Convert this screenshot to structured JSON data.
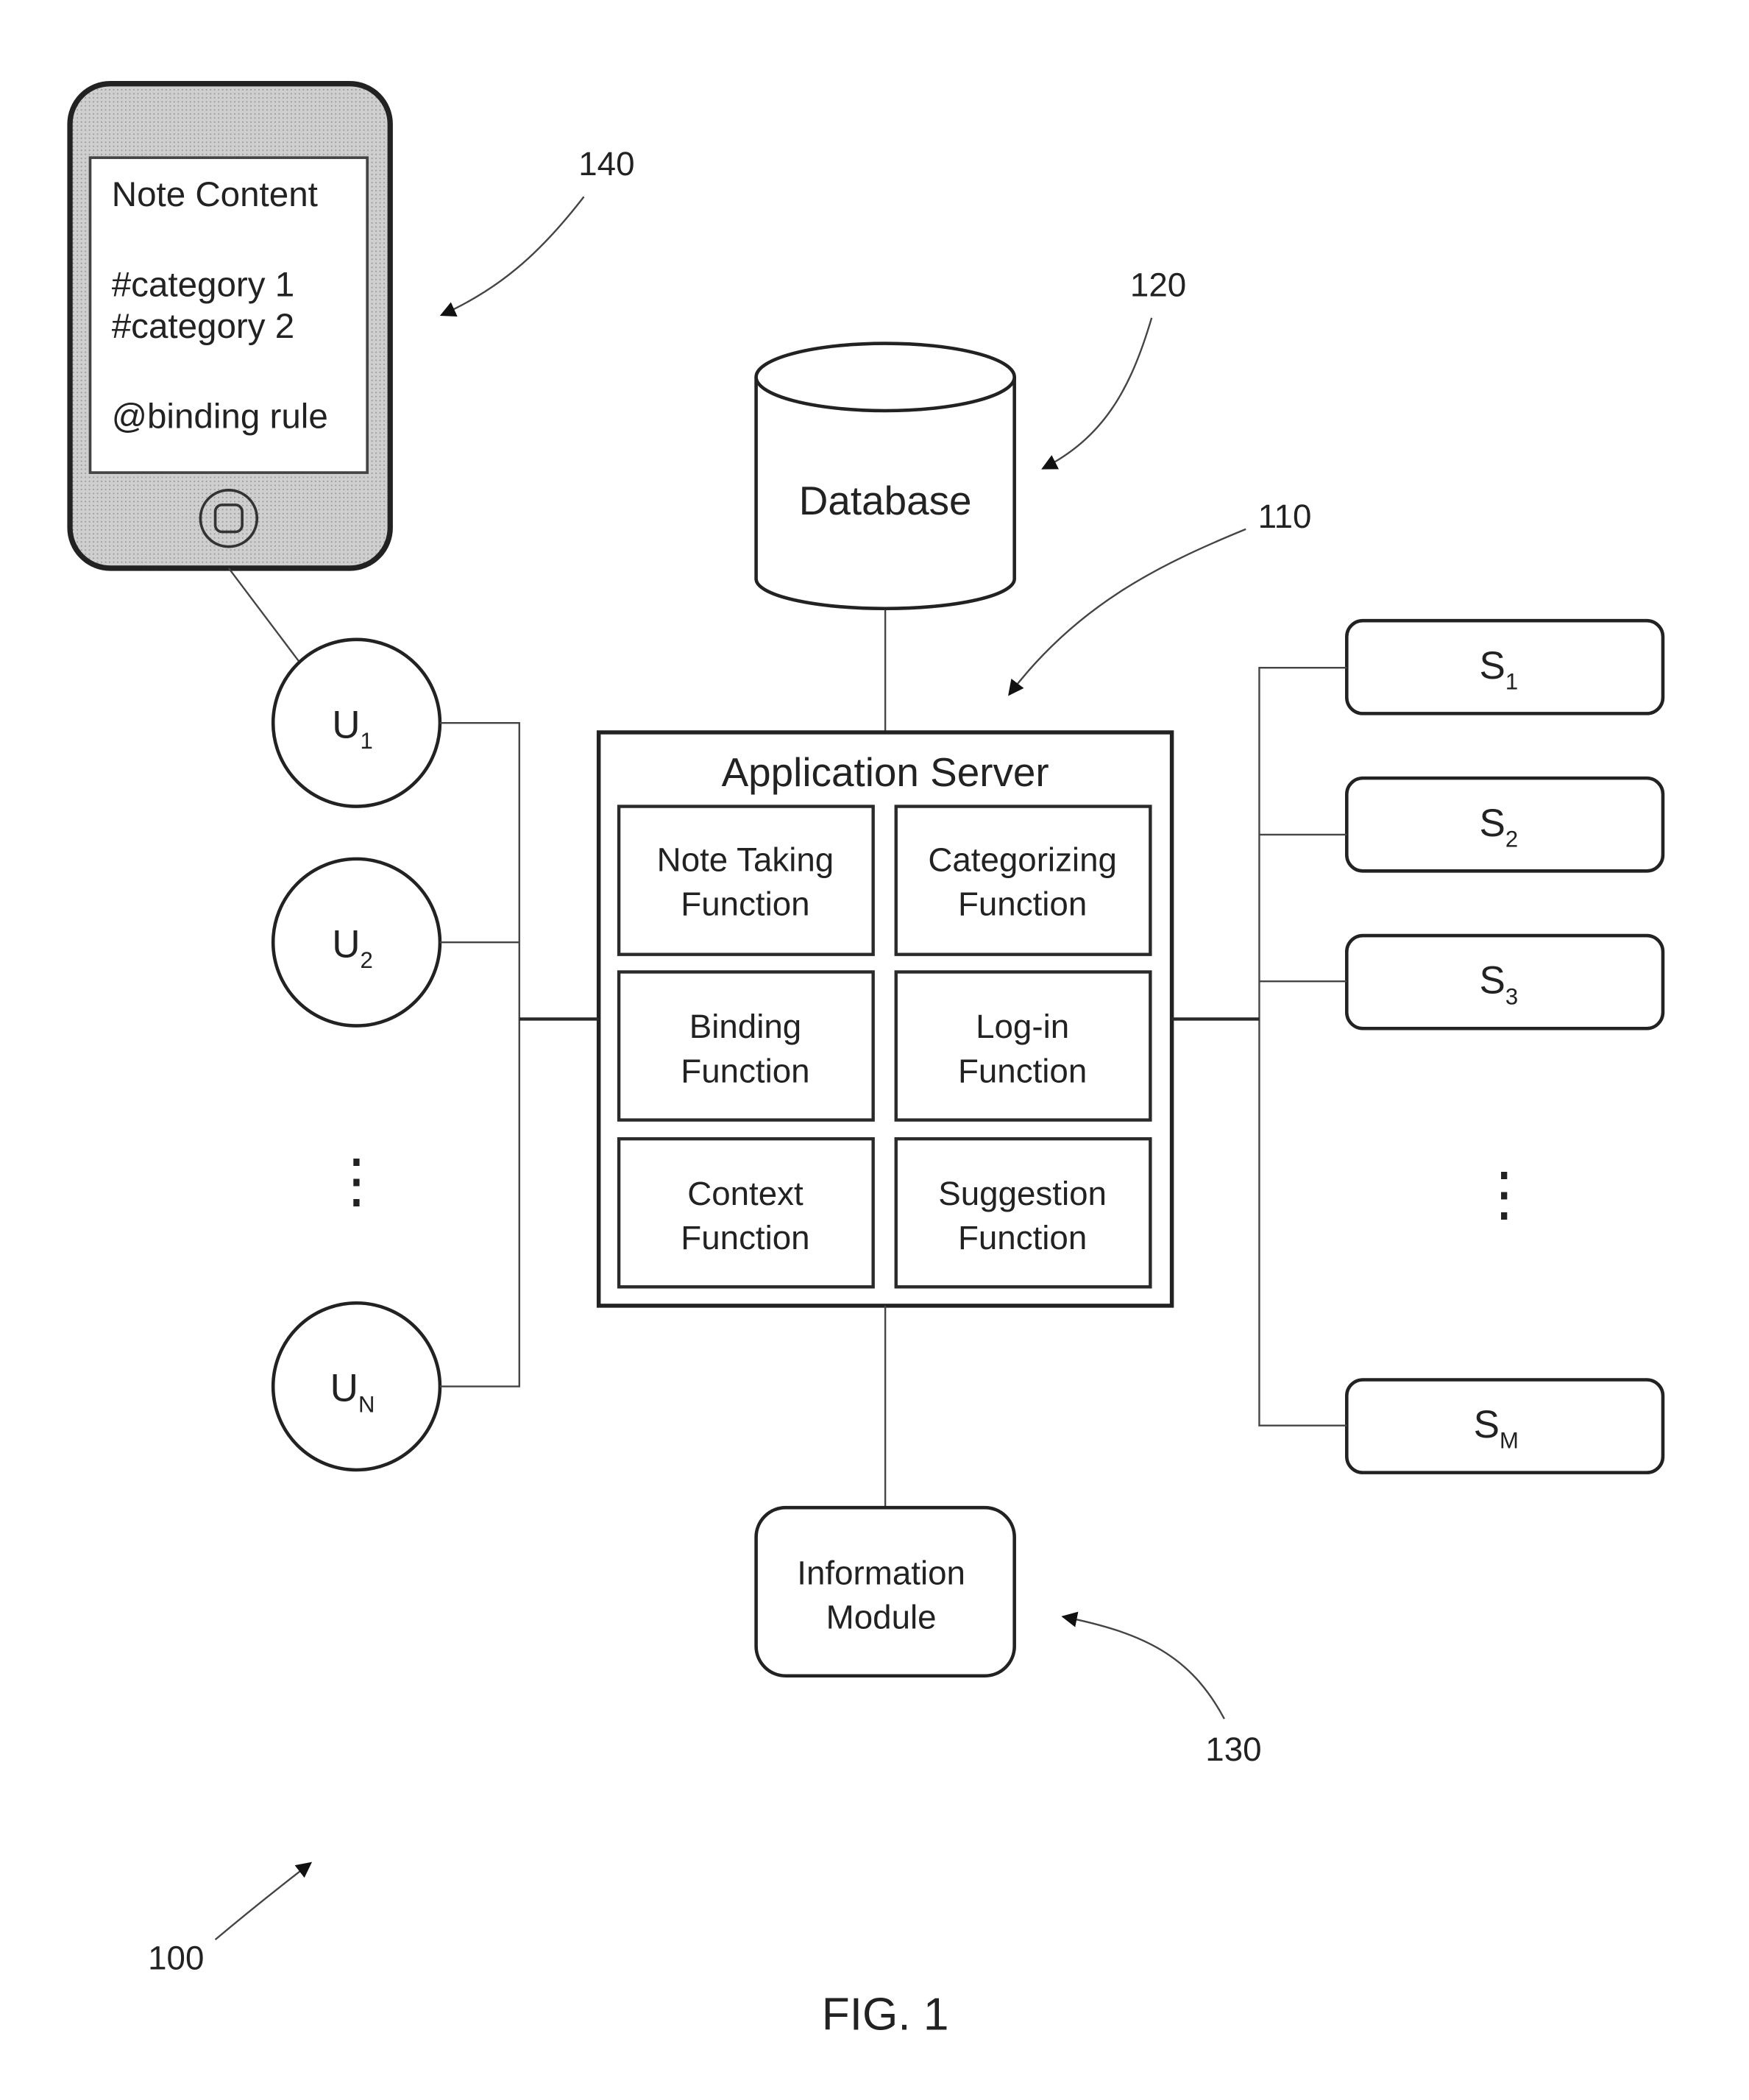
{
  "figure": {
    "caption": "FIG. 1",
    "system_ref": "100"
  },
  "device": {
    "ref": "140",
    "screen_lines": [
      "Note Content",
      "#category 1",
      "#category 2",
      "@binding rule"
    ],
    "colors": {
      "body": "#c8c8c8",
      "screen": "#ffffff"
    }
  },
  "database": {
    "ref": "120",
    "label": "Database"
  },
  "application_server": {
    "ref": "110",
    "title": "Application Server",
    "functions": [
      {
        "line1": "Note Taking",
        "line2": "Function"
      },
      {
        "line1": "Categorizing",
        "line2": "Function"
      },
      {
        "line1": "Binding",
        "line2": "Function"
      },
      {
        "line1": "Log-in",
        "line2": "Function"
      },
      {
        "line1": "Context",
        "line2": "Function"
      },
      {
        "line1": "Suggestion",
        "line2": "Function"
      }
    ]
  },
  "information_module": {
    "ref": "130",
    "line1": "Information",
    "line2": "Module"
  },
  "users": [
    {
      "base": "U",
      "sub": "1"
    },
    {
      "base": "U",
      "sub": "2"
    },
    {
      "base": "U",
      "sub": "N"
    }
  ],
  "users_ellipsis": "⋮",
  "services": [
    {
      "base": "S",
      "sub": "1"
    },
    {
      "base": "S",
      "sub": "2"
    },
    {
      "base": "S",
      "sub": "3"
    },
    {
      "base": "S",
      "sub": "M"
    }
  ],
  "services_ellipsis": "⋮"
}
